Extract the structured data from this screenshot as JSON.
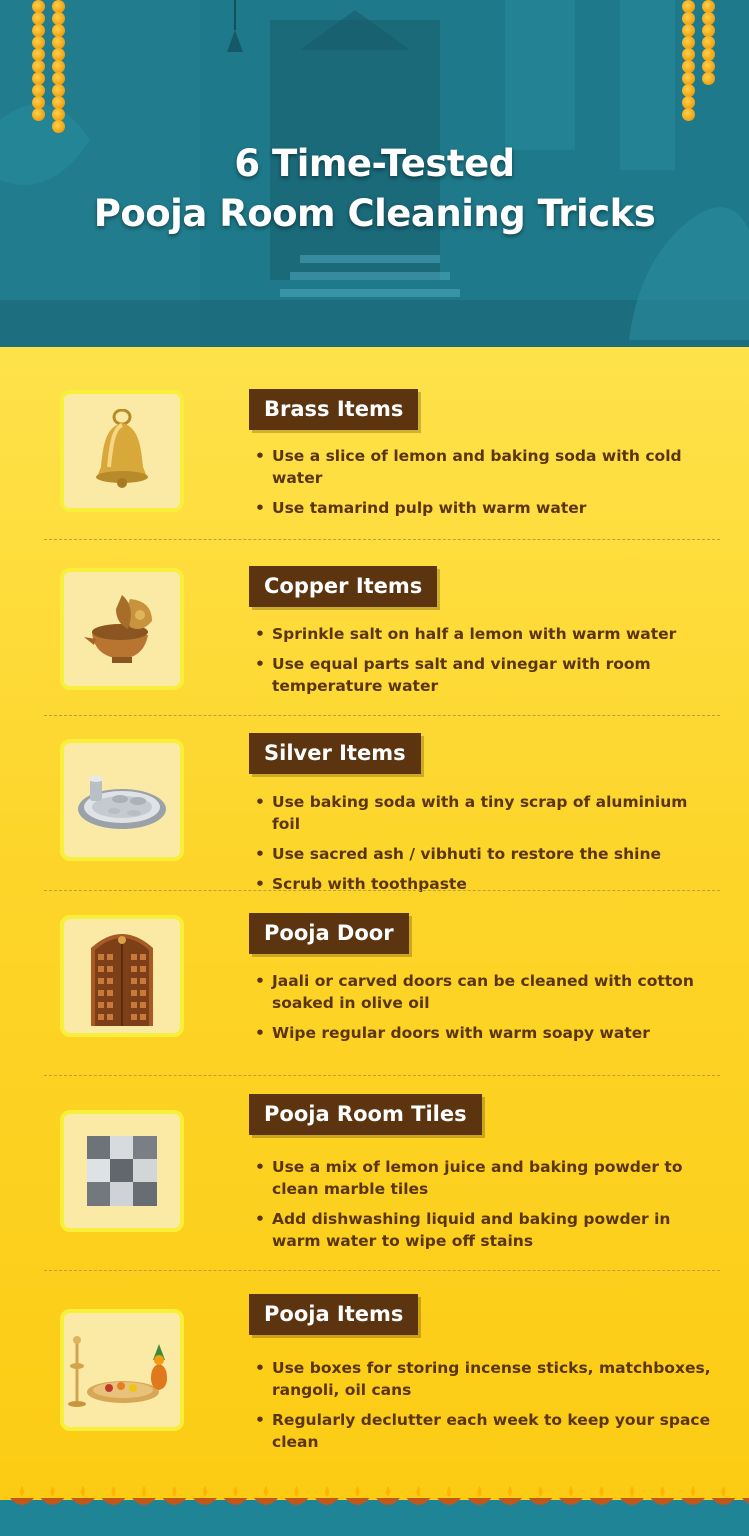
{
  "header": {
    "title_line1": "6 Time-Tested",
    "title_line2": "Pooja Room Cleaning Tricks"
  },
  "colors": {
    "header_bg": "#1c6f80",
    "content_bg": "#fcd226",
    "heading_bg": "#5c3510",
    "text": "#5a3510",
    "thumb_border": "#f8ef3a",
    "footer": "#1f8496"
  },
  "sections": [
    {
      "heading": "Brass Items",
      "icon": "bell-icon",
      "points": [
        "Use a slice of lemon and baking soda with cold water",
        "Use tamarind pulp with warm water"
      ]
    },
    {
      "heading": "Copper Items",
      "icon": "copper-diya-icon",
      "points": [
        "Sprinkle salt on half a lemon with warm water",
        "Use equal parts salt and vinegar with room temperature water"
      ]
    },
    {
      "heading": "Silver Items",
      "icon": "silver-thali-icon",
      "points": [
        "Use baking soda with a tiny scrap of aluminium foil",
        "Use sacred ash / vibhuti to restore the shine",
        "Scrub with toothpaste"
      ]
    },
    {
      "heading": "Pooja Door",
      "icon": "carved-door-icon",
      "points": [
        "Jaali or carved doors can be cleaned with cotton soaked in olive oil",
        "Wipe regular doors with warm soapy water"
      ]
    },
    {
      "heading": "Pooja Room Tiles",
      "icon": "marble-tiles-icon",
      "points": [
        "Use a mix of lemon juice and baking powder to clean marble tiles",
        "Add dishwashing liquid and baking powder in warm water to wipe off stains"
      ]
    },
    {
      "heading": "Pooja Items",
      "icon": "pooja-items-icon",
      "points": [
        "Use boxes for storing incense sticks, matchboxes, rangoli, oil cans",
        "Regularly declutter each week to keep your space clean"
      ]
    }
  ],
  "footer": {
    "decoration": "diya-lamp-icon"
  }
}
